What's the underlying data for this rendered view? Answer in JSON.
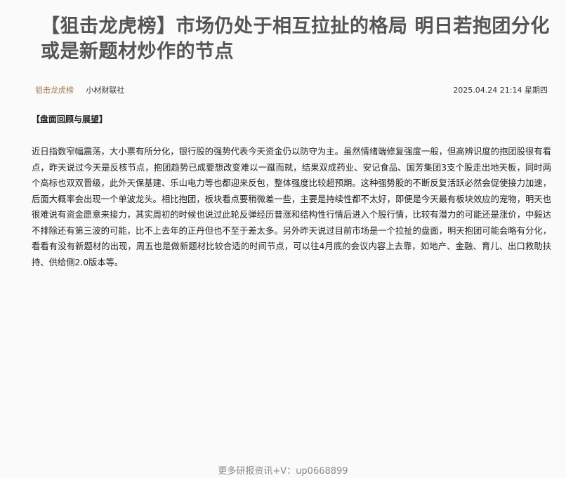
{
  "article": {
    "title": "【狙击龙虎榜】市场仍处于相互拉扯的格局 明日若抱团分化或是新题材炒作的节点",
    "column": "狙击龙虎榜",
    "author": "小材财联社",
    "timestamp": "2025.04.24 21:14 星期四",
    "section_heading": "【盘面回顾与展望】",
    "body": "近日指数窄幅震荡，大小票有所分化，银行股的强势代表今天资金仍以防守为主。虽然情绪端修复强度一般，但高辨识度的抱团股很有看点，昨天说过今天是反核节点，抱团趋势已成要想改变难以一蹴而就，结果双成药业、安记食品、国芳集团3支个股走出地天板，同时两个高标也双双晋级，此外天保基建、乐山电力等也都迎来反包，整体强度比较超预期。这种强势股的不断反复活跃必然会促使接力加速，后面大概率会出现一个单波龙头。相比抱团，板块看点要稍微差一些，主要是持续性都不太好，即便是今天最有板块效应的宠物，明天也很难说有资金愿意来接力，其实周初的时候也说过此轮反弹经历普涨和结构性行情后进入个股行情，比较有潜力的可能还是涨价，中毅达不排除还有第三波的可能，比不上去年的正丹但也不至于差太多。另外昨天说过目前市场是一个拉扯的盘面，明天抱团可能会略有分化，看看有没有新题材的出现，周五也是做新题材比较合适的时间节点，可以往4月底的会议内容上去靠，如地产、金融、育儿、出口救助扶持、供给侧2.0版本等。"
  },
  "footer": {
    "text": "更多研报资讯+V：up0668899"
  }
}
